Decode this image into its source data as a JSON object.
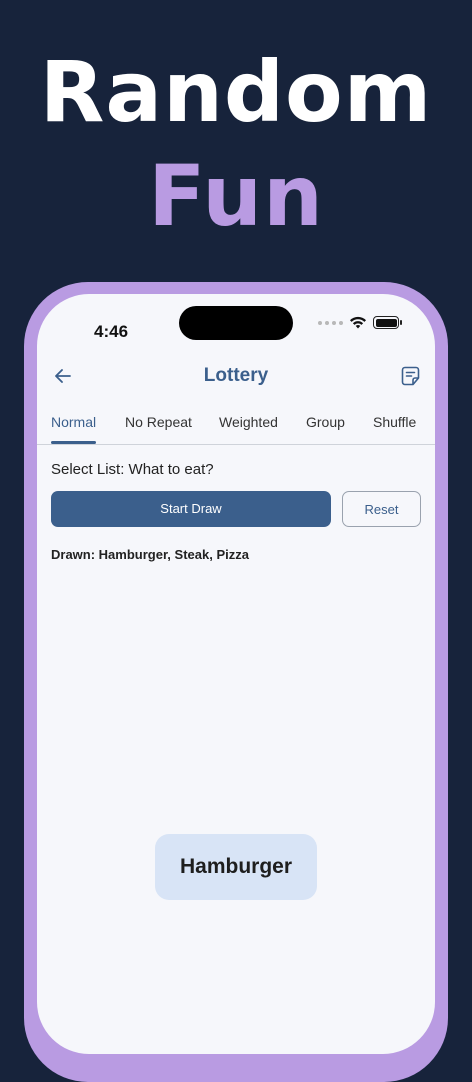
{
  "hero": {
    "line1": "Random",
    "line2": "Fun"
  },
  "status_bar": {
    "time": "4:46"
  },
  "nav": {
    "title": "Lottery",
    "back_icon": "arrow-left-icon",
    "right_icon": "note-icon"
  },
  "tabs": [
    {
      "label": "Normal",
      "active": true
    },
    {
      "label": "No Repeat",
      "active": false
    },
    {
      "label": "Weighted",
      "active": false
    },
    {
      "label": "Group",
      "active": false
    },
    {
      "label": "Shuffle",
      "active": false
    }
  ],
  "main": {
    "select_list": "Select List: What to eat?",
    "start_label": "Start Draw",
    "reset_label": "Reset",
    "drawn_text": "Drawn: Hamburger, Steak, Pizza",
    "result": "Hamburger"
  },
  "colors": {
    "background": "#17233b",
    "accent": "#b99be2",
    "primary": "#3b5f8c",
    "screen": "#f6f7fb",
    "result_card": "#d8e4f6"
  }
}
